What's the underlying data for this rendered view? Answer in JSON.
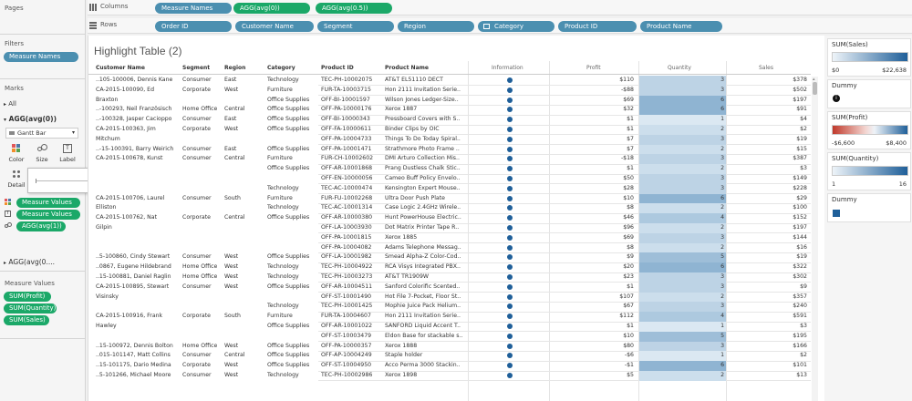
{
  "panels": {
    "pages": "Pages",
    "filters": "Filters",
    "marks": "Marks",
    "measure_values": "Measure Values"
  },
  "filters": [
    "Measure Names"
  ],
  "marks": {
    "all": "All",
    "section1": "AGG(avg(0))",
    "mark_type": "Gantt Bar",
    "buttons": [
      "Color",
      "Size",
      "Label",
      "Detail"
    ],
    "fields": [
      "Measure Values",
      "Measure Values",
      "AGG(avg(1))"
    ],
    "section2": "AGG(avg(0...."
  },
  "measure_values": [
    "SUM(Profit)",
    "SUM(Quantity)",
    "SUM(Sales)"
  ],
  "shelves": {
    "columns_label": "Columns",
    "rows_label": "Rows",
    "columns": [
      "Measure Names",
      "AGG(avg(0))",
      "AGG(avg(0.5))"
    ],
    "rows": [
      "Order ID",
      "Customer Name",
      "Segment",
      "Region",
      "Category",
      "Product ID",
      "Product Name"
    ]
  },
  "view": {
    "title": "Highlight Table (2)",
    "headers": [
      "Customer Name",
      "Segment",
      "Region",
      "Category",
      "Product ID",
      "Product Name"
    ],
    "measure_headers": [
      "Information",
      "Profit",
      "Quantity",
      "Sales"
    ]
  },
  "table": {
    "rows": [
      {
        "customer": "..105-100006, Dennis Kane",
        "segment": "Consumer",
        "region": "East",
        "category": "Technology",
        "pid": "TEC-PH-10002075",
        "pname": "AT&T EL51110 DECT",
        "profit": "$110",
        "qty": 3,
        "sales": "$378"
      },
      {
        "customer": "CA-2015-100090, Ed",
        "segment": "Corporate",
        "region": "West",
        "category": "Furniture",
        "pid": "FUR-TA-10003715",
        "pname": "Hon 2111 Invitation Serie..",
        "profit": "-$88",
        "qty": 3,
        "sales": "$502"
      },
      {
        "customer": "Braxton",
        "segment": "",
        "region": "",
        "category": "Office Supplies",
        "pid": "OFF-BI-10001597",
        "pname": "Wilson Jones Ledger-Size..",
        "profit": "$69",
        "qty": 6,
        "sales": "$197"
      },
      {
        "customer": "..-100293, Neil Französisch",
        "segment": "Home Office",
        "region": "Central",
        "category": "Office Supplies",
        "pid": "OFF-PA-10000176",
        "pname": "Xerox 1887",
        "profit": "$32",
        "qty": 6,
        "sales": "$91"
      },
      {
        "customer": "..-100328, Jasper Cacioppo",
        "segment": "Consumer",
        "region": "East",
        "category": "Office Supplies",
        "pid": "OFF-BI-10000343",
        "pname": "Pressboard Covers with S..",
        "profit": "$1",
        "qty": 1,
        "sales": "$4"
      },
      {
        "customer": "CA-2015-100363, Jim",
        "segment": "Corporate",
        "region": "West",
        "category": "Office Supplies",
        "pid": "OFF-FA-10000611",
        "pname": "Binder Clips by OIC",
        "profit": "$1",
        "qty": 2,
        "sales": "$2"
      },
      {
        "customer": "Mitchum",
        "segment": "",
        "region": "",
        "category": "",
        "pid": "OFF-PA-10004733",
        "pname": "Things To Do Today Spiral..",
        "profit": "$7",
        "qty": 3,
        "sales": "$19"
      },
      {
        "customer": "..-15-100391, Barry Weirich",
        "segment": "Consumer",
        "region": "East",
        "category": "Office Supplies",
        "pid": "OFF-PA-10001471",
        "pname": "Strathmore Photo Frame ..",
        "profit": "$7",
        "qty": 2,
        "sales": "$15"
      },
      {
        "customer": "CA-2015-100678, Kunst",
        "segment": "Consumer",
        "region": "Central",
        "category": "Furniture",
        "pid": "FUR-CH-10002602",
        "pname": "DMI Arturo Collection Mis..",
        "profit": "-$18",
        "qty": 3,
        "sales": "$387"
      },
      {
        "customer": "",
        "segment": "",
        "region": "",
        "category": "Office Supplies",
        "pid": "OFF-AR-10001868",
        "pname": "Prang Dustless Chalk Stic..",
        "profit": "$1",
        "qty": 2,
        "sales": "$3"
      },
      {
        "customer": "",
        "segment": "",
        "region": "",
        "category": "",
        "pid": "OFF-EN-10000056",
        "pname": "Cameo Buff Policy Envelo..",
        "profit": "$50",
        "qty": 3,
        "sales": "$149"
      },
      {
        "customer": "",
        "segment": "",
        "region": "",
        "category": "Technology",
        "pid": "TEC-AC-10000474",
        "pname": "Kensington Expert Mouse..",
        "profit": "$28",
        "qty": 3,
        "sales": "$228"
      },
      {
        "customer": "CA-2015-100706, Laurel",
        "segment": "Consumer",
        "region": "South",
        "category": "Furniture",
        "pid": "FUR-FU-10002268",
        "pname": "Ultra Door Push Plate",
        "profit": "$10",
        "qty": 6,
        "sales": "$29"
      },
      {
        "customer": "Elliston",
        "segment": "",
        "region": "",
        "category": "Technology",
        "pid": "TEC-AC-10001314",
        "pname": "Case Logic 2.4GHz Wirele..",
        "profit": "$8",
        "qty": 2,
        "sales": "$100"
      },
      {
        "customer": "CA-2015-100762, Nat",
        "segment": "Corporate",
        "region": "Central",
        "category": "Office Supplies",
        "pid": "OFF-AR-10000380",
        "pname": "Hunt PowerHouse Electric..",
        "profit": "$46",
        "qty": 4,
        "sales": "$152"
      },
      {
        "customer": "Gilpin",
        "segment": "",
        "region": "",
        "category": "",
        "pid": "OFF-LA-10003930",
        "pname": "Dot Matrix Printer Tape R..",
        "profit": "$96",
        "qty": 2,
        "sales": "$197"
      },
      {
        "customer": "",
        "segment": "",
        "region": "",
        "category": "",
        "pid": "OFF-PA-10001815",
        "pname": "Xerox 1885",
        "profit": "$69",
        "qty": 3,
        "sales": "$144"
      },
      {
        "customer": "",
        "segment": "",
        "region": "",
        "category": "",
        "pid": "OFF-PA-10004082",
        "pname": "Adams Telephone Messag..",
        "profit": "$8",
        "qty": 2,
        "sales": "$16"
      },
      {
        "customer": "..5-100860, Cindy Stewart",
        "segment": "Consumer",
        "region": "West",
        "category": "Office Supplies",
        "pid": "OFF-LA-10001982",
        "pname": "Smead Alpha-Z Color-Cod..",
        "profit": "$9",
        "qty": 5,
        "sales": "$19"
      },
      {
        "customer": "..0867, Eugene Hildebrand",
        "segment": "Home Office",
        "region": "West",
        "category": "Technology",
        "pid": "TEC-PH-10004922",
        "pname": "RCA Visys Integrated PBX..",
        "profit": "$20",
        "qty": 6,
        "sales": "$322"
      },
      {
        "customer": "..15-100881, Daniel Raglin",
        "segment": "Home Office",
        "region": "West",
        "category": "Technology",
        "pid": "TEC-PH-10003273",
        "pname": "AT&T TR1909W",
        "profit": "$23",
        "qty": 3,
        "sales": "$302"
      },
      {
        "customer": "CA-2015-100895, Stewart",
        "segment": "Consumer",
        "region": "West",
        "category": "Office Supplies",
        "pid": "OFF-AR-10004511",
        "pname": "Sanford Colorific Scented..",
        "profit": "$1",
        "qty": 3,
        "sales": "$9"
      },
      {
        "customer": "Visinsky",
        "segment": "",
        "region": "",
        "category": "",
        "pid": "OFF-ST-10001490",
        "pname": "Hot File 7-Pocket, Floor St..",
        "profit": "$107",
        "qty": 2,
        "sales": "$357"
      },
      {
        "customer": "",
        "segment": "",
        "region": "",
        "category": "Technology",
        "pid": "TEC-PH-10001425",
        "pname": "Mophie Juice Pack Helium..",
        "profit": "$67",
        "qty": 3,
        "sales": "$240"
      },
      {
        "customer": "CA-2015-100916, Frank",
        "segment": "Corporate",
        "region": "South",
        "category": "Furniture",
        "pid": "FUR-TA-10004607",
        "pname": "Hon 2111 Invitation Serie..",
        "profit": "$112",
        "qty": 4,
        "sales": "$591"
      },
      {
        "customer": "Hawley",
        "segment": "",
        "region": "",
        "category": "Office Supplies",
        "pid": "OFF-AR-10001022",
        "pname": "SANFORD Liquid Accent T..",
        "profit": "$1",
        "qty": 1,
        "sales": "$3"
      },
      {
        "customer": "",
        "segment": "",
        "region": "",
        "category": "",
        "pid": "OFF-ST-10003479",
        "pname": "Eldon Base for stackable s..",
        "profit": "$10",
        "qty": 5,
        "sales": "$195"
      },
      {
        "customer": "..15-100972, Dennis Bolton",
        "segment": "Home Office",
        "region": "West",
        "category": "Office Supplies",
        "pid": "OFF-PA-10000357",
        "pname": "Xerox 1888",
        "profit": "$80",
        "qty": 3,
        "sales": "$166"
      },
      {
        "customer": "..015-101147, Matt Collins",
        "segment": "Consumer",
        "region": "Central",
        "category": "Office Supplies",
        "pid": "OFF-AP-10004249",
        "pname": "Staple holder",
        "profit": "-$6",
        "qty": 1,
        "sales": "$2"
      },
      {
        "customer": "..15-101175, Dario Medina",
        "segment": "Corporate",
        "region": "West",
        "category": "Office Supplies",
        "pid": "OFF-ST-10004950",
        "pname": "Acco Perma 3000 Stackin..",
        "profit": "-$1",
        "qty": 6,
        "sales": "$101"
      },
      {
        "customer": "..5-101266, Michael Moore",
        "segment": "Consumer",
        "region": "West",
        "category": "Technology",
        "pid": "TEC-PH-10002986",
        "pname": "Xerox 1898",
        "profit": "$5",
        "qty": 2,
        "sales": "$13"
      }
    ]
  },
  "legends": {
    "sales": {
      "title": "SUM(Sales)",
      "min": "$0",
      "max": "$22,638"
    },
    "dummy1": {
      "title": "Dummy"
    },
    "profit": {
      "title": "SUM(Profit)",
      "min": "-$6,600",
      "max": "$8,400"
    },
    "quantity": {
      "title": "SUM(Quantity)",
      "min": "1",
      "max": "16"
    },
    "dummy2": {
      "title": "Dummy"
    }
  },
  "colors": {
    "pill_blue": "#4b8fb0",
    "pill_green": "#1ba868",
    "info_icon": "#1f5f99",
    "qty_light": "#dbe8f2",
    "qty_dark": "#8fb4d2"
  }
}
